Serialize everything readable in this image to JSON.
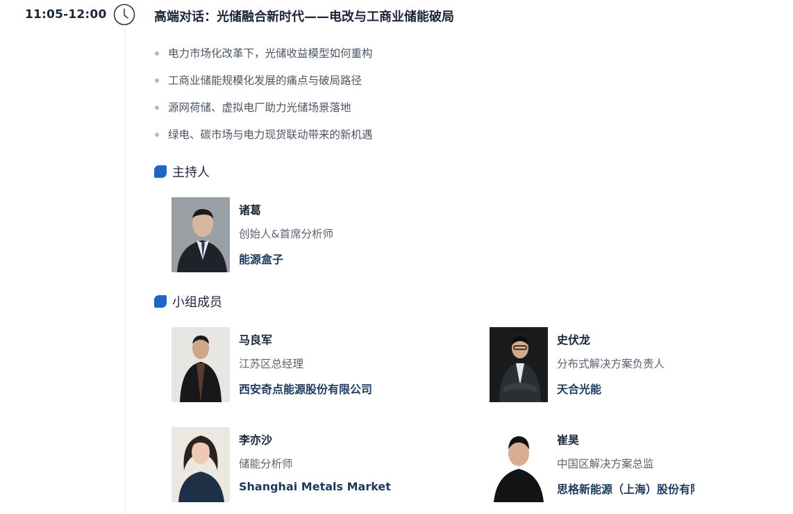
{
  "session": {
    "time": "11:05-12:00",
    "title": "高端对话：光储融合新时代——电改与工商业储能破局",
    "topics": [
      "电力市场化改革下，光储收益模型如何重构",
      "工商业储能规模化发展的痛点与破局路径",
      "源网荷储、虚拟电厂助力光储场景落地",
      "绿电、碳市场与电力现货联动带来的新机遇"
    ]
  },
  "host_section": {
    "title": "主持人",
    "people": [
      {
        "name": "诸葛",
        "role": "创始人&首席分析师",
        "org": "能源盒子"
      }
    ]
  },
  "panel_section": {
    "title": "小组成员",
    "people": [
      {
        "name": "马良军",
        "role": "江苏区总经理",
        "org": "西安奇点能源股份有限公司"
      },
      {
        "name": "史伏龙",
        "role": "分布式解决方案负责人",
        "org": "天合光能"
      },
      {
        "name": "李亦沙",
        "role": "储能分析师",
        "org": "Shanghai Metals Market"
      },
      {
        "name": "崔昊",
        "role": "中国区解决方案总监",
        "org": "思格新能源（上海）股份有限公司"
      }
    ]
  },
  "colors": {
    "accent": "#1d66c6",
    "text": "#1b2638",
    "muted": "#5a6270"
  }
}
